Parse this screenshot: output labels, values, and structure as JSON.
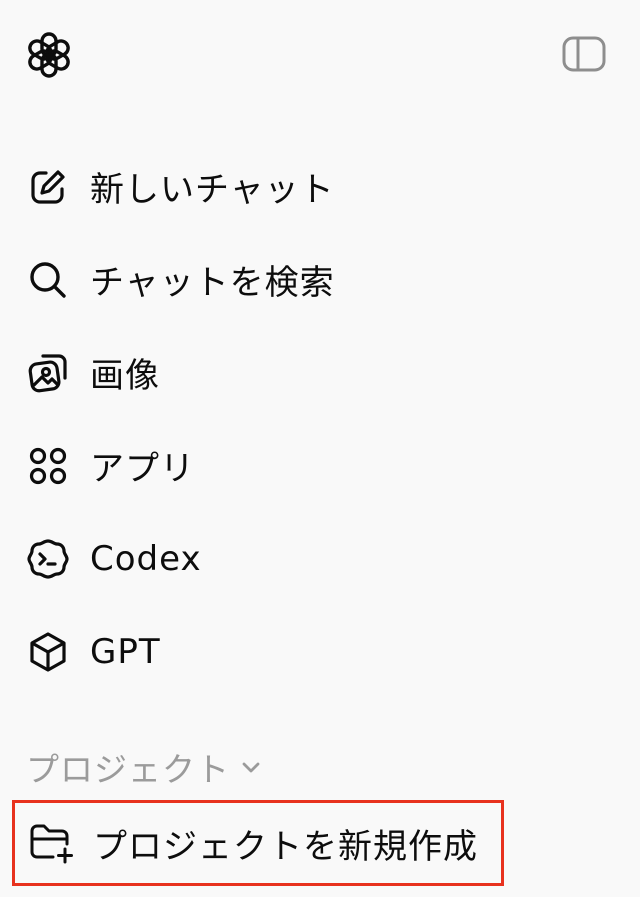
{
  "header": {
    "logo_icon": "openai-logo-icon",
    "toggle_icon": "sidebar-toggle-icon"
  },
  "nav": {
    "items": [
      {
        "label": "新しいチャット",
        "icon": "edit-icon"
      },
      {
        "label": "チャットを検索",
        "icon": "search-icon"
      },
      {
        "label": "画像",
        "icon": "images-icon"
      },
      {
        "label": "アプリ",
        "icon": "apps-icon"
      },
      {
        "label": "Codex",
        "icon": "codex-icon"
      },
      {
        "label": "GPT",
        "icon": "cube-icon"
      }
    ]
  },
  "projects": {
    "section_label": "プロジェクト",
    "new_project_label": "プロジェクトを新規作成",
    "new_project_icon": "folder-plus-icon"
  },
  "colors": {
    "background": "#f9f9f9",
    "text": "#0d0d0d",
    "muted": "#9b9b9b",
    "highlight": "#e8321e"
  }
}
